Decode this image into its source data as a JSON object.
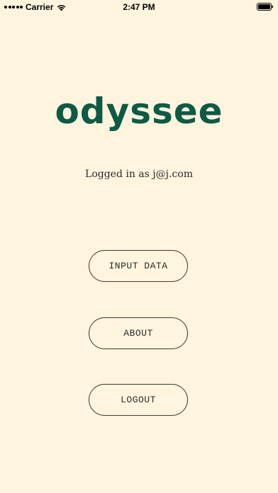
{
  "status_bar": {
    "carrier": "Carrier",
    "time": "2:47 PM",
    "signal_icon": "signal-dots-icon",
    "wifi_icon": "wifi-icon",
    "battery_icon": "battery-icon"
  },
  "app": {
    "logo_text": "odyssee",
    "logo_color": "#0d5a45",
    "background_color": "#FFF4DE"
  },
  "session": {
    "logged_in_text": "Logged in as j@j.com"
  },
  "menu": {
    "input_data_label": "INPUT DATA",
    "about_label": "ABOUT",
    "logout_label": "LOGOUT"
  }
}
